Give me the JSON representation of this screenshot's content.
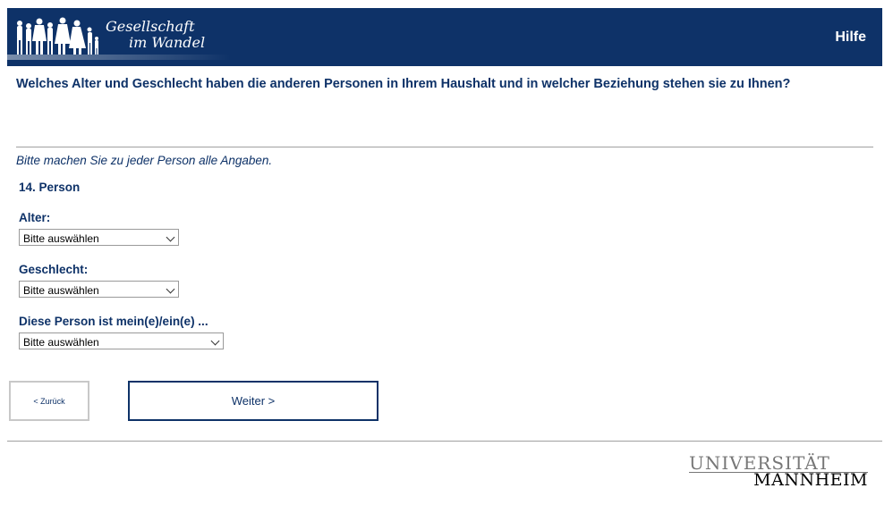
{
  "header": {
    "logo_line1": "Gesellschaft",
    "logo_line2": "im Wandel",
    "help_label": "Hilfe",
    "background_color": "#0e3268"
  },
  "question": "Welches Alter und Geschlecht haben die anderen Personen in Ihrem Haushalt und in welcher Beziehung stehen sie zu Ihnen?",
  "instruction": "Bitte machen Sie zu jeder Person alle Angaben.",
  "person_heading": "14. Person",
  "fields": [
    {
      "label": "Alter:",
      "selected": "Bitte auswählen"
    },
    {
      "label": "Geschlecht:",
      "selected": "Bitte auswählen"
    },
    {
      "label": "Diese Person ist mein(e)/ein(e) ...",
      "selected": "Bitte auswählen"
    }
  ],
  "nav": {
    "back_label": "< Zurück",
    "next_label": "Weiter >"
  },
  "footer": {
    "university_line1": "UNIVERSITÄT",
    "university_line2": "MANNHEIM"
  }
}
